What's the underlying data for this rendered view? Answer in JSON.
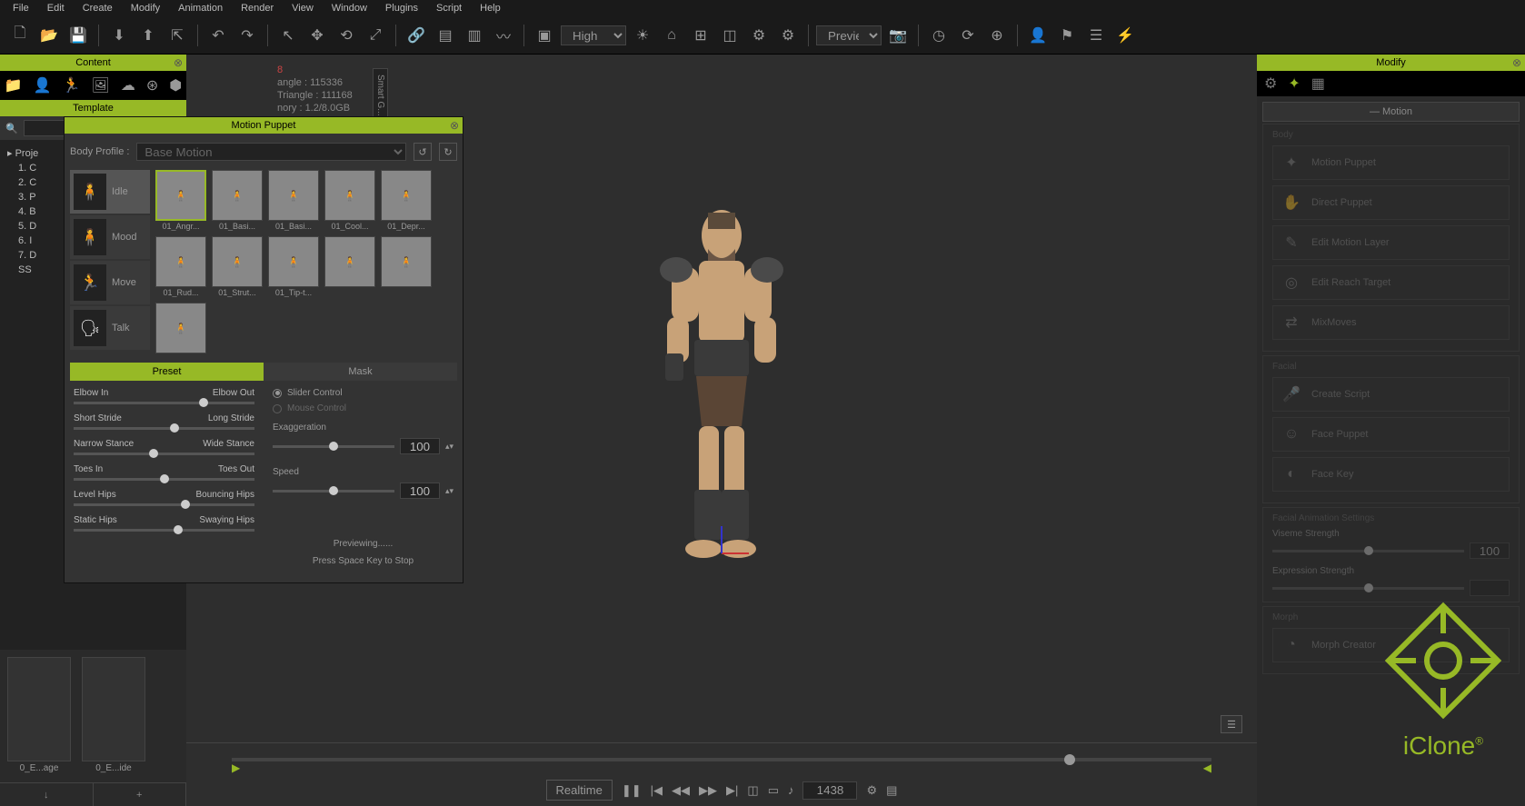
{
  "menubar": [
    "File",
    "Edit",
    "Create",
    "Modify",
    "Animation",
    "Render",
    "View",
    "Window",
    "Plugins",
    "Script",
    "Help"
  ],
  "toolbar": {
    "quality": "High",
    "preview": "Preview"
  },
  "content": {
    "title": "Content",
    "tab": "Template",
    "search": "",
    "tree_root": "Proje",
    "tree_items": [
      "1. C",
      "2. C",
      "3. P",
      "4. B",
      "5. D",
      "6. I",
      "7. D",
      "SS"
    ],
    "thumbs": [
      "0_E...age",
      "0_E...ide"
    ]
  },
  "motion_puppet": {
    "title": "Motion Puppet",
    "body_profile_label": "Body Profile :",
    "body_profile_value": "Base Motion",
    "categories": [
      {
        "name": "Idle"
      },
      {
        "name": "Mood"
      },
      {
        "name": "Move"
      },
      {
        "name": "Talk"
      }
    ],
    "presets": [
      "01_Angr...",
      "01_Basi...",
      "01_Basi...",
      "01_Cool...",
      "01_Depr...",
      "01_Rud...",
      "01_Strut...",
      "01_Tip-t...",
      "",
      "",
      ""
    ],
    "tab_preset": "Preset",
    "tab_mask": "Mask",
    "sliders": [
      {
        "left": "Elbow In",
        "right": "Elbow Out",
        "pos": 72
      },
      {
        "left": "Short Stride",
        "right": "Long Stride",
        "pos": 56
      },
      {
        "left": "Narrow Stance",
        "right": "Wide Stance",
        "pos": 44
      },
      {
        "left": "Toes In",
        "right": "Toes Out",
        "pos": 50
      },
      {
        "left": "Level Hips",
        "right": "Bouncing Hips",
        "pos": 62
      },
      {
        "left": "Static Hips",
        "right": "Swaying Hips",
        "pos": 58
      }
    ],
    "radio_slider": "Slider Control",
    "radio_mouse": "Mouse Control",
    "exaggeration_label": "Exaggeration",
    "exaggeration_val": "100",
    "speed_label": "Speed",
    "speed_val": "100",
    "previewing": "Previewing......",
    "press_space": "Press Space Key to Stop"
  },
  "viewport": {
    "stat1": "8",
    "stat2": "angle : 115336",
    "stat3": "Triangle : 111168",
    "stat4": "nory : 1.2/8.0GB"
  },
  "timeline": {
    "mode": "Realtime",
    "frame": "1438"
  },
  "modify": {
    "title": "Modify",
    "section": "Motion",
    "body_group": "Body",
    "body_btns": [
      "Motion Puppet",
      "Direct Puppet",
      "Edit Motion Layer",
      "Edit Reach Target",
      "MixMoves"
    ],
    "facial_group": "Facial",
    "facial_btns": [
      "Create Script",
      "Face Puppet",
      "Face Key"
    ],
    "anim_group": "Facial Animation Settings",
    "viseme": "Viseme Strength",
    "viseme_val": "100",
    "expr": "Expression Strength",
    "morph_group": "Morph",
    "morph_btn": "Morph Creator"
  },
  "logo": "iClone",
  "smart_gallery": "Smart G..."
}
